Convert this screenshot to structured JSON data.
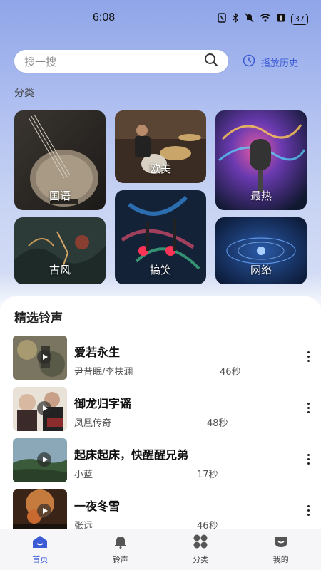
{
  "status": {
    "time": "6:08",
    "battery": "37"
  },
  "search": {
    "placeholder": "搜一搜",
    "history_label": "播放历史"
  },
  "categories_label": "分类",
  "categories": [
    {
      "label": "国语"
    },
    {
      "label": "欧美"
    },
    {
      "label": "最热"
    },
    {
      "label": "古风"
    },
    {
      "label": "搞笑"
    },
    {
      "label": "网络"
    }
  ],
  "featured": {
    "title": "精选铃声",
    "songs": [
      {
        "title": "爱若永生",
        "artist": "尹昔眠/李扶澜",
        "duration": "46秒"
      },
      {
        "title": "御龙归字谣",
        "artist": "凤凰传奇",
        "duration": "48秒"
      },
      {
        "title": "起床起床，快醒醒兄弟",
        "artist": "小蓝",
        "duration": "17秒"
      },
      {
        "title": "一夜冬雪",
        "artist": "张远",
        "duration": "46秒"
      }
    ]
  },
  "nav": [
    {
      "label": "首页",
      "icon": "home-icon"
    },
    {
      "label": "铃声",
      "icon": "bell-icon"
    },
    {
      "label": "分类",
      "icon": "grid-icon"
    },
    {
      "label": "我的",
      "icon": "profile-icon"
    }
  ],
  "colors": {
    "accent": "#3b5bd6"
  }
}
